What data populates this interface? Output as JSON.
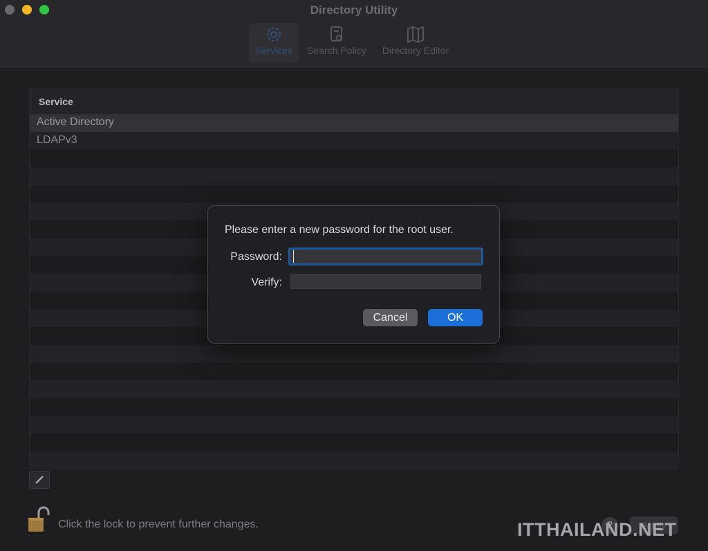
{
  "window": {
    "title": "Directory Utility"
  },
  "toolbar": {
    "items": [
      {
        "label": "Services",
        "icon": "gear-icon",
        "selected": true
      },
      {
        "label": "Search Policy",
        "icon": "search-policy-icon"
      },
      {
        "label": "Directory Editor",
        "icon": "map-icon"
      }
    ]
  },
  "services": {
    "column_header": "Service",
    "rows": [
      {
        "label": "Active Directory",
        "selected": true
      },
      {
        "label": "LDAPv3"
      }
    ]
  },
  "footer": {
    "lock_text": "Click the lock to prevent further changes.",
    "help_label": "?",
    "apply_label": "Apply",
    "watermark": "ITTHAILAND.NET"
  },
  "dialog": {
    "message": "Please enter a new password for the root user.",
    "password_label": "Password:",
    "password_value": "",
    "verify_label": "Verify:",
    "verify_value": "",
    "cancel_label": "Cancel",
    "ok_label": "OK"
  },
  "colors": {
    "accent": "#1c6fd8",
    "close": "#6a696d",
    "minimize": "#f6b627",
    "maximize": "#2ec446"
  }
}
